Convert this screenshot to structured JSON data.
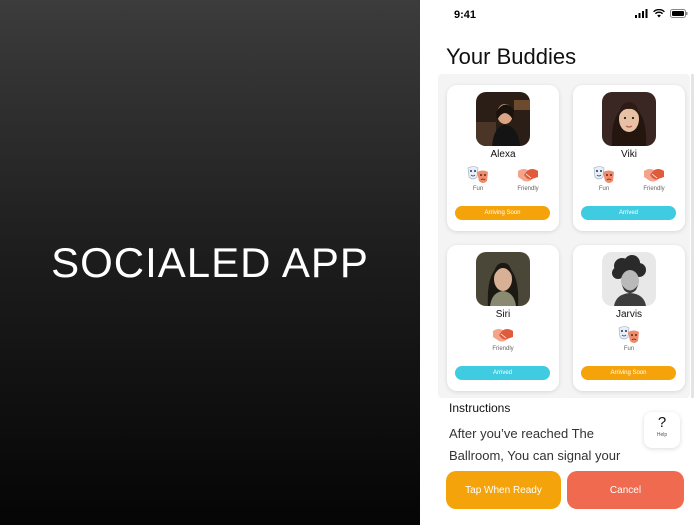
{
  "promo": {
    "title": "SOCIALED APP"
  },
  "status_bar": {
    "time": "9:41"
  },
  "page": {
    "title": "Your Buddies"
  },
  "buddies": [
    {
      "name": "Alexa",
      "traits": [
        "Fun",
        "Friendly"
      ],
      "status": "Arriving Soon",
      "status_color": "#f5a30b"
    },
    {
      "name": "Viki",
      "traits": [
        "Fun",
        "Friendly"
      ],
      "status": "Arrived",
      "status_color": "#3fcbe0"
    },
    {
      "name": "Siri",
      "traits": [
        "Friendly"
      ],
      "status": "Arrived",
      "status_color": "#3fcbe0"
    },
    {
      "name": "Jarvis",
      "traits": [
        "Fun"
      ],
      "status": "Arriving Soon",
      "status_color": "#f5a30b"
    }
  ],
  "instructions": {
    "heading": "Instructions",
    "text": "After you’ve reached The Ballroom, You can signal your"
  },
  "help": {
    "icon": "?",
    "label": "Help"
  },
  "actions": {
    "ready_label": "Tap When Ready",
    "cancel_label": "Cancel"
  },
  "colors": {
    "orange": "#f5a30b",
    "teal": "#3fcbe0",
    "cancel": "#ef6a4f"
  }
}
